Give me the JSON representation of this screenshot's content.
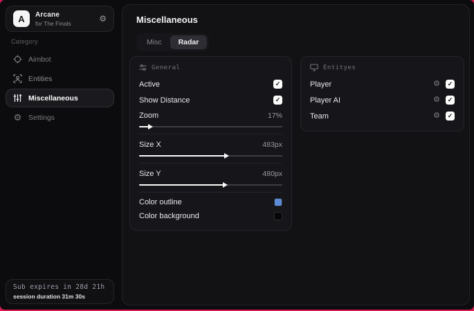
{
  "icons": {
    "gear": "⚙",
    "check": "✓"
  },
  "accents": {
    "crimson": "#d81b53",
    "blue": "#5b8bd8",
    "black": "#060606"
  },
  "sidebar": {
    "brand": {
      "logo_letter": "A",
      "title": "Arcane",
      "subtitle": "for The Finals"
    },
    "category_label": "Category",
    "items": [
      {
        "label": "Aimbot",
        "active": false
      },
      {
        "label": "Entities",
        "active": false
      },
      {
        "label": "Miscellaneous",
        "active": true
      },
      {
        "label": "Settings",
        "active": false
      }
    ],
    "subscription": {
      "expires": "Sub expires in 28d 21h",
      "session": "session duration 31m 30s"
    }
  },
  "main": {
    "title": "Miscellaneous",
    "tabs": [
      {
        "label": "Misc",
        "active": false
      },
      {
        "label": "Radar",
        "active": true
      }
    ],
    "general_panel": {
      "title": "General",
      "toggles": [
        {
          "label": "Active",
          "checked": true
        },
        {
          "label": "Show Distance",
          "checked": true
        }
      ],
      "sliders": [
        {
          "label": "Zoom",
          "value": "17%",
          "fill_percent": 7
        },
        {
          "label": "Size X",
          "value": "483px",
          "fill_percent": 60
        },
        {
          "label": "Size Y",
          "value": "480px",
          "fill_percent": 59
        }
      ],
      "colors": [
        {
          "label": "Color outline",
          "swatch": "#5b8bd8"
        },
        {
          "label": "Color background",
          "swatch": "#060606"
        }
      ]
    },
    "entities_panel": {
      "title": "Entityes",
      "rows": [
        {
          "label": "Player",
          "checked": true
        },
        {
          "label": "Player AI",
          "checked": true
        },
        {
          "label": "Team",
          "checked": true
        }
      ]
    }
  }
}
